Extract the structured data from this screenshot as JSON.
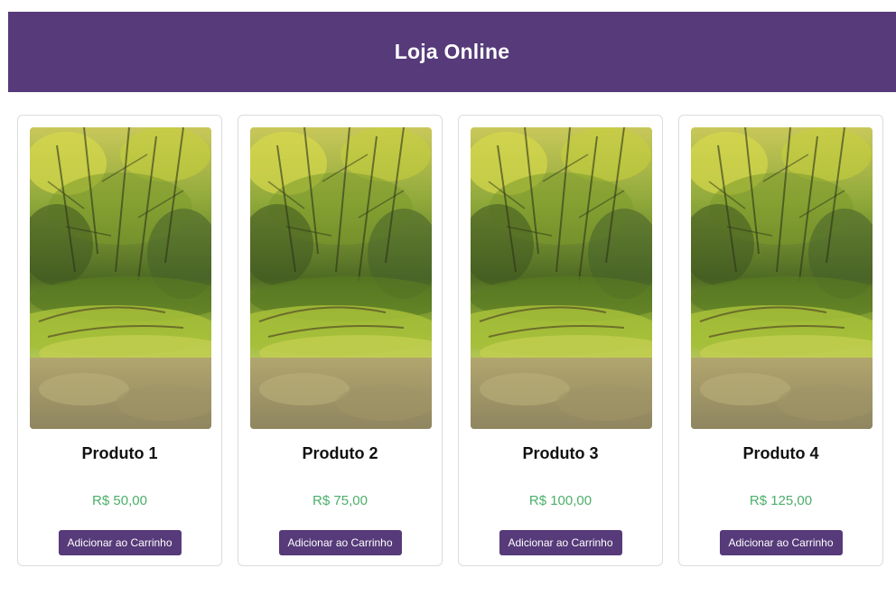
{
  "header": {
    "title": "Loja Online"
  },
  "colors": {
    "brand": "#563a79",
    "price": "#4caf6a"
  },
  "products": [
    {
      "name": "Produto 1",
      "price": "R$ 50,00",
      "button_label": "Adicionar ao Carrinho"
    },
    {
      "name": "Produto 2",
      "price": "R$ 75,00",
      "button_label": "Adicionar ao Carrinho"
    },
    {
      "name": "Produto 3",
      "price": "R$ 100,00",
      "button_label": "Adicionar ao Carrinho"
    },
    {
      "name": "Produto 4",
      "price": "R$ 125,00",
      "button_label": "Adicionar ao Carrinho"
    }
  ]
}
